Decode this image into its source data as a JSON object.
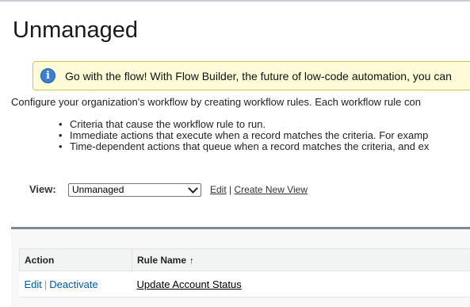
{
  "page": {
    "title": "Unmanaged"
  },
  "banner": {
    "icon": "info-icon",
    "text": "Go with the flow! With Flow Builder, the future of low-code automation, you can"
  },
  "intro": "Configure your organization's workflow by creating workflow rules. Each workflow rule con",
  "bullets": [
    "Criteria that cause the workflow rule to run.",
    "Immediate actions that execute when a record matches the criteria. For examp",
    "Time-dependent actions that queue when a record matches the criteria, and ex"
  ],
  "view": {
    "label": "View:",
    "selected": "Unmanaged",
    "edit_link": "Edit",
    "separator": "|",
    "create_link": "Create New View"
  },
  "table": {
    "headers": {
      "action": "Action",
      "rule_name": "Rule Name",
      "sort_indicator": "↑"
    },
    "rows": [
      {
        "edit": "Edit",
        "separator": "|",
        "deactivate": "Deactivate",
        "rule_name": "Update Account Status"
      }
    ]
  }
}
